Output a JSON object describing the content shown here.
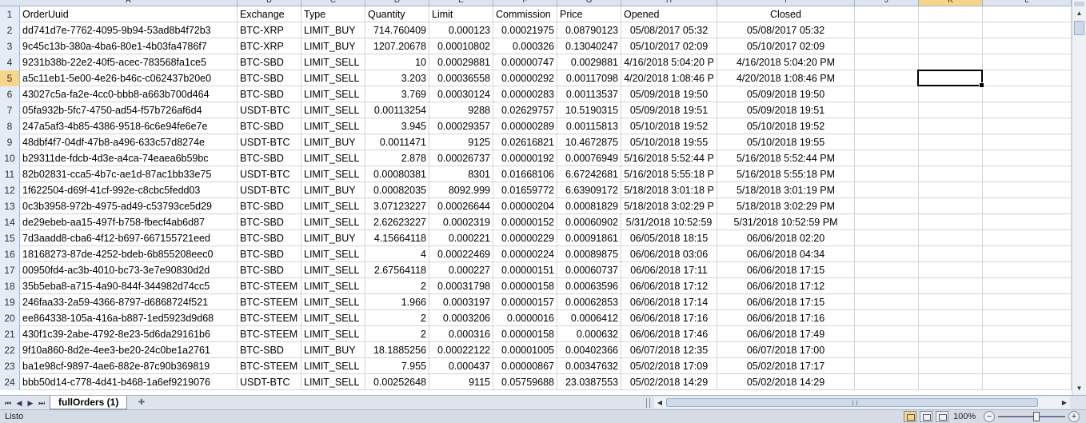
{
  "column_letters": [
    "A",
    "B",
    "C",
    "D",
    "E",
    "F",
    "G",
    "H",
    "I",
    "J",
    "K",
    "L"
  ],
  "selected_column": "K",
  "selected_row": "5",
  "rows": [
    {
      "n": "1",
      "cells": [
        "OrderUuid",
        "Exchange",
        "Type",
        "Quantity",
        "Limit",
        "Commission",
        "Price",
        "Opened",
        "Closed"
      ]
    },
    {
      "n": "2",
      "cells": [
        "dd741d7e-7762-4095-9b94-53ad8b4f72b3",
        "BTC-XRP",
        "LIMIT_BUY",
        "714.760409",
        "0.000123",
        "0.00021975",
        "0.08790123",
        "05/08/2017 05:32",
        "05/08/2017 05:32"
      ]
    },
    {
      "n": "3",
      "cells": [
        "9c45c13b-380a-4ba6-80e1-4b03fa4786f7",
        "BTC-XRP",
        "LIMIT_BUY",
        "1207.20678",
        "0.00010802",
        "0.000326",
        "0.13040247",
        "05/10/2017 02:09",
        "05/10/2017 02:09"
      ]
    },
    {
      "n": "4",
      "cells": [
        "9231b38b-22e2-40f5-acec-783568fa1ce5",
        "BTC-SBD",
        "LIMIT_SELL",
        "10",
        "0.00029881",
        "0.00000747",
        "0.0029881",
        "4/16/2018 5:04:20 P",
        "4/16/2018 5:04:20 PM"
      ]
    },
    {
      "n": "5",
      "cells": [
        "a5c11eb1-5e00-4e26-b46c-c062437b20e0",
        "BTC-SBD",
        "LIMIT_SELL",
        "3.203",
        "0.00036558",
        "0.00000292",
        "0.00117098",
        "4/20/2018 1:08:46 P",
        "4/20/2018 1:08:46 PM"
      ]
    },
    {
      "n": "6",
      "cells": [
        "43027c5a-fa2e-4cc0-bbb8-a663b700d464",
        "BTC-SBD",
        "LIMIT_SELL",
        "3.769",
        "0.00030124",
        "0.00000283",
        "0.00113537",
        "05/09/2018 19:50",
        "05/09/2018 19:50"
      ]
    },
    {
      "n": "7",
      "cells": [
        "05fa932b-5fc7-4750-ad54-f57b726af6d4",
        "USDT-BTC",
        "LIMIT_SELL",
        "0.00113254",
        "9288",
        "0.02629757",
        "10.5190315",
        "05/09/2018 19:51",
        "05/09/2018 19:51"
      ]
    },
    {
      "n": "8",
      "cells": [
        "247a5af3-4b85-4386-9518-6c6e94fe6e7e",
        "BTC-SBD",
        "LIMIT_SELL",
        "3.945",
        "0.00029357",
        "0.00000289",
        "0.00115813",
        "05/10/2018 19:52",
        "05/10/2018 19:52"
      ]
    },
    {
      "n": "9",
      "cells": [
        "48dbf4f7-04df-47b8-a496-633c57d8274e",
        "USDT-BTC",
        "LIMIT_BUY",
        "0.0011471",
        "9125",
        "0.02616821",
        "10.4672875",
        "05/10/2018 19:55",
        "05/10/2018 19:55"
      ]
    },
    {
      "n": "10",
      "cells": [
        "b29311de-fdcb-4d3e-a4ca-74eaea6b59bc",
        "BTC-SBD",
        "LIMIT_SELL",
        "2.878",
        "0.00026737",
        "0.00000192",
        "0.00076949",
        "5/16/2018 5:52:44 P",
        "5/16/2018 5:52:44 PM"
      ]
    },
    {
      "n": "11",
      "cells": [
        "82b02831-cca5-4b7c-ae1d-87ac1bb33e75",
        "USDT-BTC",
        "LIMIT_SELL",
        "0.00080381",
        "8301",
        "0.01668106",
        "6.67242681",
        "5/16/2018 5:55:18 P",
        "5/16/2018 5:55:18 PM"
      ]
    },
    {
      "n": "12",
      "cells": [
        "1f622504-d69f-41cf-992e-c8cbc5fedd03",
        "USDT-BTC",
        "LIMIT_BUY",
        "0.00082035",
        "8092.999",
        "0.01659772",
        "6.63909172",
        "5/18/2018 3:01:18 P",
        "5/18/2018 3:01:19 PM"
      ]
    },
    {
      "n": "13",
      "cells": [
        "0c3b3958-972b-4975-ad49-c53793ce5d29",
        "BTC-SBD",
        "LIMIT_SELL",
        "3.07123227",
        "0.00026644",
        "0.00000204",
        "0.00081829",
        "5/18/2018 3:02:29 P",
        "5/18/2018 3:02:29 PM"
      ]
    },
    {
      "n": "14",
      "cells": [
        "de29ebeb-aa15-497f-b758-fbecf4ab6d87",
        "BTC-SBD",
        "LIMIT_SELL",
        "2.62623227",
        "0.0002319",
        "0.00000152",
        "0.00060902",
        "5/31/2018 10:52:59",
        "5/31/2018 10:52:59 PM"
      ]
    },
    {
      "n": "15",
      "cells": [
        "7d3aadd8-cba6-4f12-b697-667155721eed",
        "BTC-SBD",
        "LIMIT_BUY",
        "4.15664118",
        "0.000221",
        "0.00000229",
        "0.00091861",
        "06/05/2018 18:15",
        "06/06/2018 02:20"
      ]
    },
    {
      "n": "16",
      "cells": [
        "18168273-87de-4252-bdeb-6b855208eec0",
        "BTC-SBD",
        "LIMIT_SELL",
        "4",
        "0.00022469",
        "0.00000224",
        "0.00089875",
        "06/06/2018 03:06",
        "06/06/2018 04:34"
      ]
    },
    {
      "n": "17",
      "cells": [
        "00950fd4-ac3b-4010-bc73-3e7e90830d2d",
        "BTC-SBD",
        "LIMIT_SELL",
        "2.67564118",
        "0.000227",
        "0.00000151",
        "0.00060737",
        "06/06/2018 17:11",
        "06/06/2018 17:15"
      ]
    },
    {
      "n": "18",
      "cells": [
        "35b5eba8-a715-4a90-844f-344982d74cc5",
        "BTC-STEEM",
        "LIMIT_SELL",
        "2",
        "0.00031798",
        "0.00000158",
        "0.00063596",
        "06/06/2018 17:12",
        "06/06/2018 17:12"
      ]
    },
    {
      "n": "19",
      "cells": [
        "246faa33-2a59-4366-8797-d6868724f521",
        "BTC-STEEM",
        "LIMIT_SELL",
        "1.966",
        "0.0003197",
        "0.00000157",
        "0.00062853",
        "06/06/2018 17:14",
        "06/06/2018 17:15"
      ]
    },
    {
      "n": "20",
      "cells": [
        "ee864338-105a-416a-b887-1ed5923d9d68",
        "BTC-STEEM",
        "LIMIT_SELL",
        "2",
        "0.0003206",
        "0.0000016",
        "0.0006412",
        "06/06/2018 17:16",
        "06/06/2018 17:16"
      ]
    },
    {
      "n": "21",
      "cells": [
        "430f1c39-2abe-4792-8e23-5d6da29161b6",
        "BTC-STEEM",
        "LIMIT_SELL",
        "2",
        "0.000316",
        "0.00000158",
        "0.000632",
        "06/06/2018 17:46",
        "06/06/2018 17:49"
      ]
    },
    {
      "n": "22",
      "cells": [
        "9f10a860-8d2e-4ee3-be20-24c0be1a2761",
        "BTC-SBD",
        "LIMIT_BUY",
        "18.1885256",
        "0.00022122",
        "0.00001005",
        "0.00402366",
        "06/07/2018 12:35",
        "06/07/2018 17:00"
      ]
    },
    {
      "n": "23",
      "cells": [
        "ba1e98cf-9897-4ae6-882e-87c90b369819",
        "BTC-STEEM",
        "LIMIT_SELL",
        "7.955",
        "0.000437",
        "0.00000867",
        "0.00347632",
        "05/02/2018 17:09",
        "05/02/2018 17:17"
      ]
    },
    {
      "n": "24",
      "cells": [
        "bbb50d14-c778-4d41-b468-1a6ef9219076",
        "USDT-BTC",
        "LIMIT_SELL",
        "0.00252648",
        "9115",
        "0.05759688",
        "23.0387553",
        "05/02/2018 14:29",
        "05/02/2018 14:29"
      ]
    }
  ],
  "sheet_tab": "fullOrders (1)",
  "status_text": "Listo",
  "zoom": "100%",
  "icons": {
    "nav_first": "first-sheet-icon",
    "nav_prev": "prev-sheet-icon",
    "nav_next": "next-sheet-icon",
    "nav_last": "last-sheet-icon",
    "new_sheet": "insert-sheet-icon"
  },
  "colors": {
    "header_bg": "#dfe5ee",
    "selected_header": "#f7d58a",
    "gridline": "#d4d4d4"
  }
}
